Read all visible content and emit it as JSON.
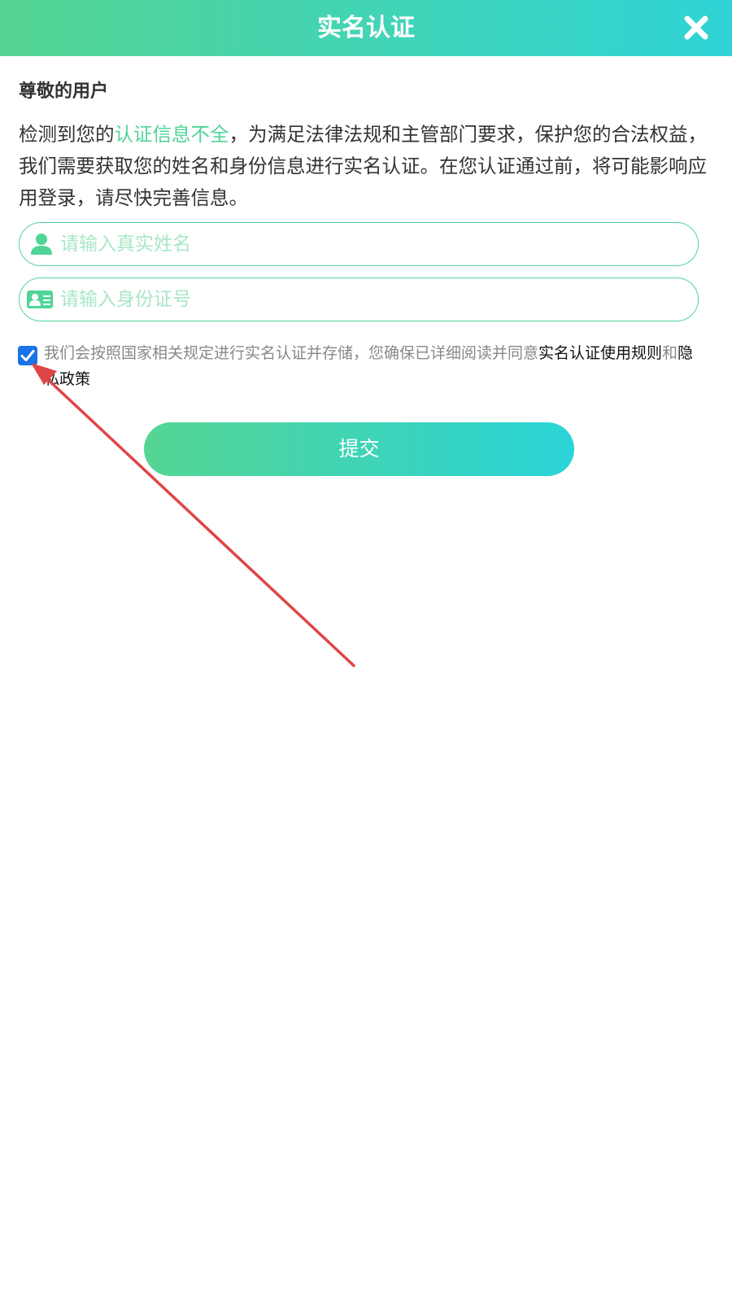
{
  "header": {
    "title": "实名认证",
    "close_icon": "close-icon"
  },
  "greeting": "尊敬的用户",
  "notice": {
    "part1": "检测到您的",
    "highlight": "认证信息不全",
    "part2": "，为满足法律法规和主管部门要求，保护您的合法权益，我们需要获取您的姓名和身份信息进行实名认证。在您认证通过前，将可能影响应用登录，请尽快完善信息。"
  },
  "form": {
    "name_placeholder": "请输入真实姓名",
    "name_value": "",
    "name_icon": "user-icon",
    "id_placeholder": "请输入身份证号",
    "id_value": "",
    "id_icon": "id-card-icon"
  },
  "agreement": {
    "checked": true,
    "text": "我们会按照国家相关规定进行实名认证并存储，您确保已详细阅读并同意",
    "link_rules": "实名认证使用规则",
    "conjunction": "和",
    "link_privacy": "隐私政策"
  },
  "submit_label": "提交",
  "colors": {
    "accent_green": "#55d593",
    "accent_cyan": "#2fd3d6",
    "checkbox_blue": "#1a73e8",
    "annotation_red": "#e04545"
  }
}
